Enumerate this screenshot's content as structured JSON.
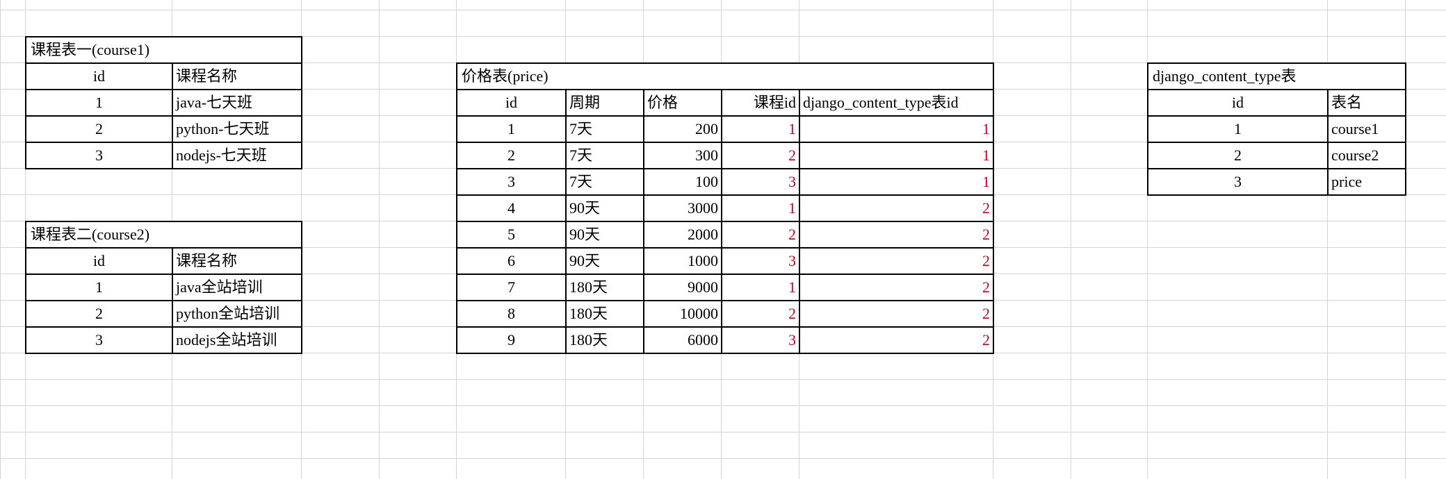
{
  "course1": {
    "title": "课程表一(course1)",
    "headers": [
      "id",
      "课程名称"
    ],
    "rows": [
      [
        "1",
        "java-七天班"
      ],
      [
        "2",
        "python-七天班"
      ],
      [
        "3",
        "nodejs-七天班"
      ]
    ]
  },
  "course2": {
    "title": "课程表二(course2)",
    "headers": [
      "id",
      "课程名称"
    ],
    "rows": [
      [
        "1",
        "java全站培训"
      ],
      [
        "2",
        "python全站培训"
      ],
      [
        "3",
        "nodejs全站培训"
      ]
    ]
  },
  "price": {
    "title": "价格表(price)",
    "headers": [
      "id",
      "周期",
      "价格",
      "课程id",
      "django_content_type表id"
    ],
    "rows": [
      [
        "1",
        "7天",
        "200",
        "1",
        "1"
      ],
      [
        "2",
        "7天",
        "300",
        "2",
        "1"
      ],
      [
        "3",
        "7天",
        "100",
        "3",
        "1"
      ],
      [
        "4",
        "90天",
        "3000",
        "1",
        "2"
      ],
      [
        "5",
        "90天",
        "2000",
        "2",
        "2"
      ],
      [
        "6",
        "90天",
        "1000",
        "3",
        "2"
      ],
      [
        "7",
        "180天",
        "9000",
        "1",
        "2"
      ],
      [
        "8",
        "180天",
        "10000",
        "2",
        "2"
      ],
      [
        "9",
        "180天",
        "6000",
        "3",
        "2"
      ]
    ]
  },
  "content_type": {
    "title": "django_content_type表",
    "headers": [
      "id",
      "表名"
    ],
    "rows": [
      [
        "1",
        "course1"
      ],
      [
        "2",
        "course2"
      ],
      [
        "3",
        "price"
      ]
    ]
  },
  "colors": {
    "grid": "#d4d4d4",
    "border": "#000000",
    "highlight": "#d0021b"
  }
}
